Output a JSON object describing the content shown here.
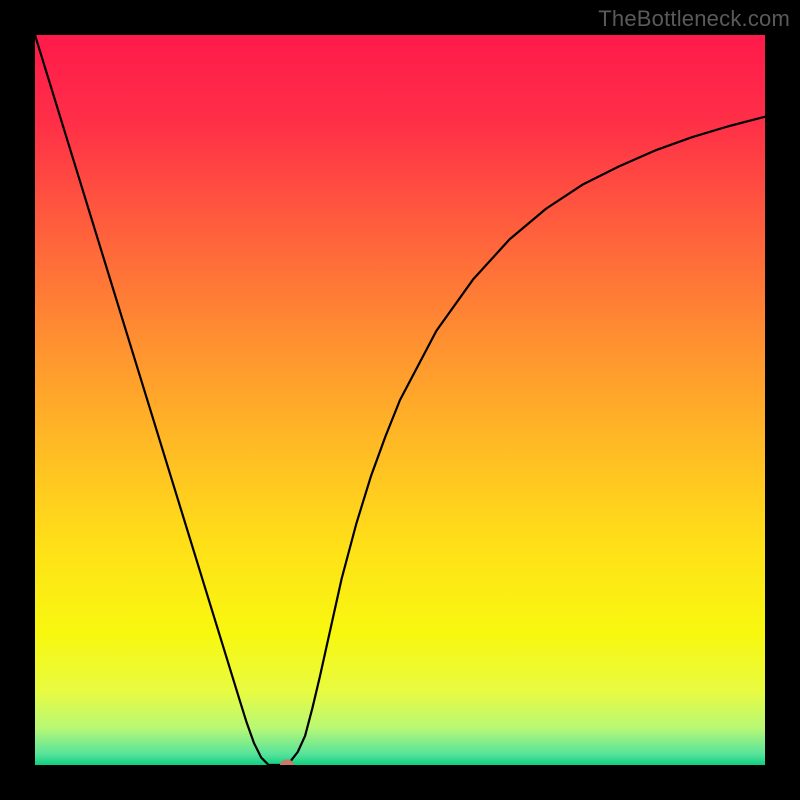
{
  "watermark": "TheBottleneck.com",
  "chart_data": {
    "type": "line",
    "title": "",
    "xlabel": "",
    "ylabel": "",
    "xlim": [
      0,
      1
    ],
    "ylim": [
      0,
      1
    ],
    "x": [
      0.0,
      0.02,
      0.04,
      0.06,
      0.08,
      0.1,
      0.12,
      0.14,
      0.16,
      0.18,
      0.2,
      0.22,
      0.24,
      0.26,
      0.28,
      0.29,
      0.3,
      0.31,
      0.32,
      0.33,
      0.34,
      0.35,
      0.36,
      0.37,
      0.38,
      0.39,
      0.4,
      0.42,
      0.44,
      0.46,
      0.48,
      0.5,
      0.55,
      0.6,
      0.65,
      0.7,
      0.75,
      0.8,
      0.85,
      0.9,
      0.95,
      1.0
    ],
    "values": [
      1.0,
      0.935,
      0.87,
      0.805,
      0.74,
      0.675,
      0.61,
      0.545,
      0.48,
      0.415,
      0.35,
      0.285,
      0.22,
      0.155,
      0.09,
      0.058,
      0.03,
      0.01,
      0.0,
      0.0,
      0.0,
      0.005,
      0.018,
      0.04,
      0.078,
      0.12,
      0.165,
      0.255,
      0.33,
      0.395,
      0.45,
      0.5,
      0.595,
      0.665,
      0.72,
      0.762,
      0.795,
      0.82,
      0.842,
      0.86,
      0.875,
      0.888
    ],
    "marker_point": {
      "x": 0.345,
      "y": 0.0
    },
    "gradient_stops": [
      {
        "offset": 0.0,
        "color": "#ff1a4b"
      },
      {
        "offset": 0.12,
        "color": "#ff2f47"
      },
      {
        "offset": 0.25,
        "color": "#ff5a3e"
      },
      {
        "offset": 0.4,
        "color": "#ff8a32"
      },
      {
        "offset": 0.55,
        "color": "#ffb726"
      },
      {
        "offset": 0.7,
        "color": "#ffe018"
      },
      {
        "offset": 0.82,
        "color": "#f8f80f"
      },
      {
        "offset": 0.9,
        "color": "#e8fb42"
      },
      {
        "offset": 0.95,
        "color": "#b6f876"
      },
      {
        "offset": 0.985,
        "color": "#57e39b"
      },
      {
        "offset": 1.0,
        "color": "#0ed07f"
      }
    ]
  }
}
